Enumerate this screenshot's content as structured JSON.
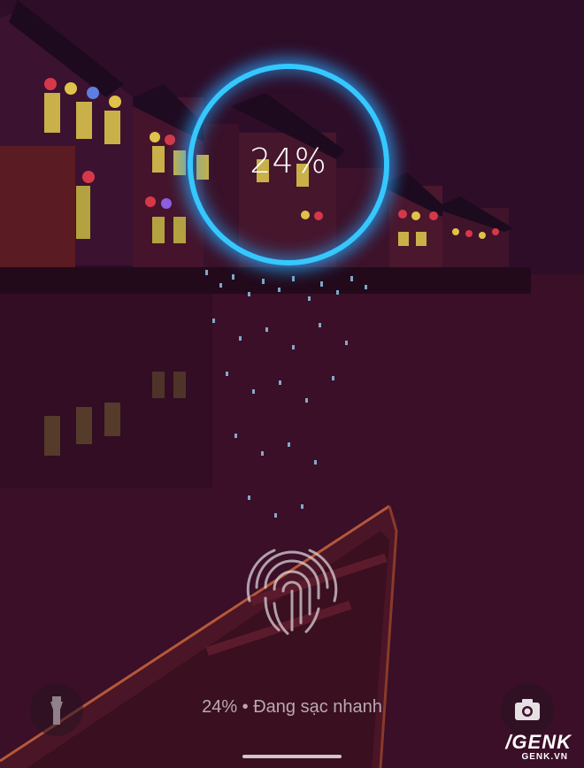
{
  "lockscreen": {
    "charge_percent": "24%",
    "charging_status": "24% • Đang sạc nhanh",
    "battery_level": 0.24
  },
  "icons": {
    "flashlight": "flashlight-icon",
    "camera": "camera-icon",
    "fingerprint": "fingerprint-icon"
  },
  "colors": {
    "ring": "#35c8ff",
    "background": "#3a1027"
  },
  "watermark": {
    "main": "/GENK",
    "sub": "GENK.VN"
  }
}
